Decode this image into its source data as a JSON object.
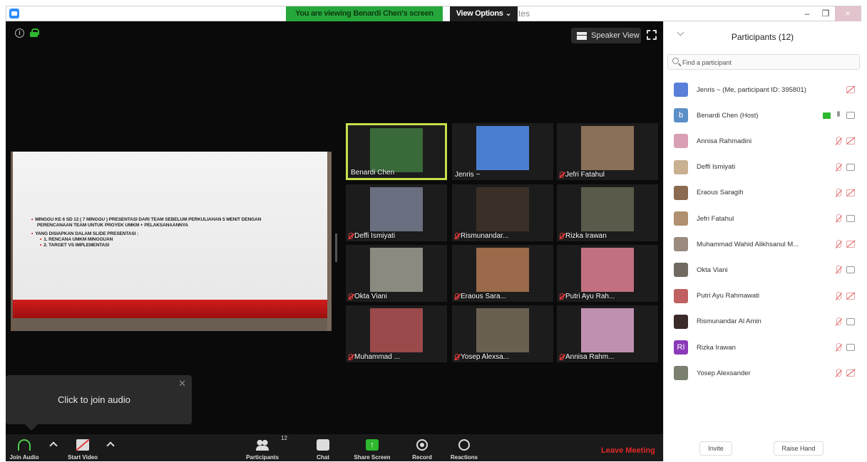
{
  "titlebar": {
    "banner": "You are viewing Benardi Chen's screen",
    "view_options": "View Options ⌄",
    "title_fragment": "tes",
    "minimize": "–",
    "restore": "❐",
    "close": "×"
  },
  "stage": {
    "speaker_view": "Speaker View",
    "slide": {
      "bullet1_line1": "MINGGU KE 6 SD 12 ( 7 MINGGU ) PRESENTASI DARI TEAM SEBELUM PERKULIAHAN 5 MENIT DENGAN",
      "bullet1_line2": "PERENCANAAN TEAM UNTUK PROYEK UMKM + PELAKSANAANNYA",
      "bullet2": "YANG DISIAPKAN DALAM SLIDE PRESENTASI :",
      "sub1": "1. RENCANA UMKM MINGGUAN",
      "sub2": "2. TARGET VS IMPLEMENTASI"
    },
    "gallery": [
      {
        "name": "Benardi Chen",
        "muted": false,
        "active": true,
        "color": "#3a6a3a"
      },
      {
        "name": "Jenris ~",
        "muted": false,
        "active": false,
        "color": "#4a7fd0"
      },
      {
        "name": "Jefri Fatahul",
        "muted": true,
        "active": false,
        "color": "#8a7058"
      },
      {
        "name": "Deffi Ismiyati",
        "muted": true,
        "active": false,
        "color": "#6a6f80"
      },
      {
        "name": "Rismunandar...",
        "muted": true,
        "active": false,
        "color": "#3a3028"
      },
      {
        "name": "Rizka Irawan",
        "muted": true,
        "active": false,
        "color": "#5a5a4a"
      },
      {
        "name": "Okta Viani",
        "muted": true,
        "active": false,
        "color": "#8a8a80"
      },
      {
        "name": "Eraous Sara...",
        "muted": true,
        "active": false,
        "color": "#9a6a4a"
      },
      {
        "name": "Putri Ayu Rah...",
        "muted": true,
        "active": false,
        "color": "#c07080"
      },
      {
        "name": "Muhammad ...",
        "muted": true,
        "active": false,
        "color": "#9a4a4a"
      },
      {
        "name": "Yosep Alexsa...",
        "muted": true,
        "active": false,
        "color": "#6a6050"
      },
      {
        "name": "Annisa Rahm...",
        "muted": true,
        "active": false,
        "color": "#c090b0"
      }
    ]
  },
  "join_popup": {
    "text": "Click to join audio",
    "close": "✕"
  },
  "toolbar": {
    "join_audio": "Join Audio",
    "start_video": "Start Video",
    "participants": "Participants",
    "participants_count": "12",
    "chat": "Chat",
    "share_screen": "Share Screen",
    "share_arrow": "↑",
    "record": "Record",
    "reactions": "Reactions",
    "leave": "Leave Meeting"
  },
  "panel": {
    "title": "Participants (12)",
    "search_placeholder": "Find a participant",
    "participants": [
      {
        "name": "Jenris ~ (Me, participant ID: 395801)",
        "avatar": "",
        "avatar_color": "#5a7fd8",
        "mic": "none",
        "cam": "muted"
      },
      {
        "name": "Benardi Chen (Host)",
        "avatar": "b",
        "avatar_color": "#5b8fc7",
        "mic": "on",
        "cam": "on",
        "sharing": true
      },
      {
        "name": "Annisa Rahmadini",
        "avatar": "",
        "avatar_color": "#d9a0b5",
        "mic": "muted",
        "cam": "muted"
      },
      {
        "name": "Deffi Ismiyati",
        "avatar": "",
        "avatar_color": "#c8b090",
        "mic": "muted",
        "cam": "on"
      },
      {
        "name": "Eraous Saragih",
        "avatar": "",
        "avatar_color": "#8a6a50",
        "mic": "muted",
        "cam": "muted"
      },
      {
        "name": "Jefri Fatahul",
        "avatar": "",
        "avatar_color": "#b09070",
        "mic": "muted",
        "cam": "on"
      },
      {
        "name": "Muhammad Wahid Alikhsanul M...",
        "avatar": "",
        "avatar_color": "#9a8a80",
        "mic": "muted",
        "cam": "muted"
      },
      {
        "name": "Okta Viani",
        "avatar": "",
        "avatar_color": "#706a60",
        "mic": "muted",
        "cam": "on"
      },
      {
        "name": "Putri Ayu Rahmawati",
        "avatar": "",
        "avatar_color": "#c06060",
        "mic": "muted",
        "cam": "muted"
      },
      {
        "name": "Rismunandar Al Amin",
        "avatar": "",
        "avatar_color": "#3a2a2a",
        "mic": "muted",
        "cam": "on"
      },
      {
        "name": "Rizka Irawan",
        "avatar": "RI",
        "avatar_color": "#8a3ab8",
        "mic": "muted",
        "cam": "on"
      },
      {
        "name": "Yosep Alexsander",
        "avatar": "",
        "avatar_color": "#7a8070",
        "mic": "muted",
        "cam": "muted"
      }
    ],
    "invite": "Invite",
    "raise_hand": "Raise Hand"
  }
}
